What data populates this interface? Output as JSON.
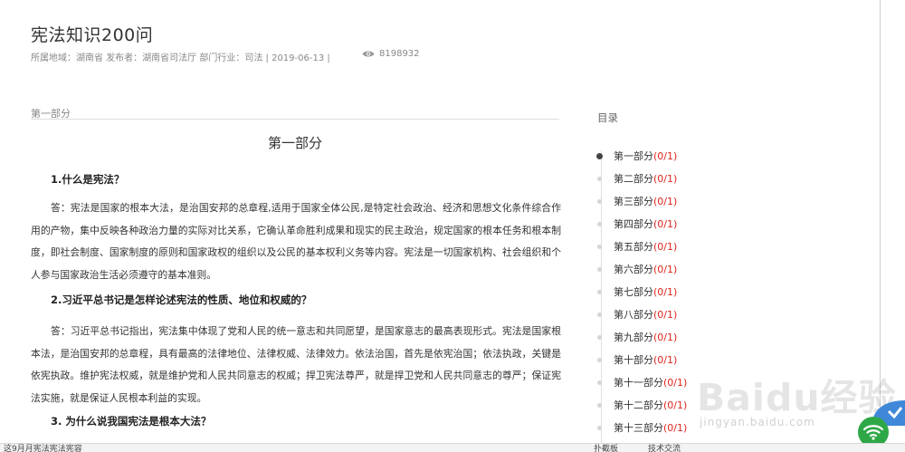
{
  "article": {
    "title": "宪法知识200问",
    "meta": "所属地域：湖南省 发布者：湖南省司法厅 部门行业：司法 | 2019-06-13 |",
    "views": "8198932",
    "section_label": "第一部分",
    "section_heading": "第一部分"
  },
  "qa": [
    {
      "q": "1.什么是宪法？",
      "a": "答：宪法是国家的根本大法，是治国安邦的总章程,适用于国家全体公民,是特定社会政治、经济和思想文化条件综合作用的产物，集中反映各种政治力量的实际对比关系，它确认革命胜利成果和现实的民主政治，规定国家的根本任务和根本制度，即社会制度、国家制度的原则和国家政权的组织以及公民的基本权利义务等内容。宪法是一切国家机构、社会组织和个人参与国家政治生活必须遵守的基本准则。"
    },
    {
      "q": "2.习近平总书记是怎样论述宪法的性质、地位和权威的？",
      "a": "答：习近平总书记指出，宪法集中体现了党和人民的统一意志和共同愿望，是国家意志的最高表现形式。宪法是国家根本法，是治国安邦的总章程，具有最高的法律地位、法律权威、法律效力。依法治国，首先是依宪治国；依法执政，关键是依宪执政。维护宪法权威，就是维护党和人民共同意志的权威；捍卫宪法尊严，就是捍卫党和人民共同意志的尊严；保证宪法实施，就是保证人民根本利益的实现。"
    },
    {
      "q": "3. 为什么说我国宪法是根本大法？",
      "a": ""
    }
  ],
  "toc": {
    "title": "目录",
    "items": [
      {
        "label": "第一部分",
        "count": "(0/1)"
      },
      {
        "label": "第二部分",
        "count": "(0/1)"
      },
      {
        "label": "第三部分",
        "count": "(0/1)"
      },
      {
        "label": "第四部分",
        "count": "(0/1)"
      },
      {
        "label": "第五部分",
        "count": "(0/1)"
      },
      {
        "label": "第六部分",
        "count": "(0/1)"
      },
      {
        "label": "第七部分",
        "count": "(0/1)"
      },
      {
        "label": "第八部分",
        "count": "(0/1)"
      },
      {
        "label": "第九部分",
        "count": "(0/1)"
      },
      {
        "label": "第十部分",
        "count": "(0/1)"
      },
      {
        "label": "第十一部分",
        "count": "(0/1)"
      },
      {
        "label": "第十二部分",
        "count": "(0/1)"
      },
      {
        "label": "第十三部分",
        "count": "(0/1)"
      }
    ]
  },
  "watermark": {
    "brand": "Baidu经验",
    "url": "jingyan.baidu.com"
  },
  "bottom_bar": {
    "left_text": "这9月月宪法宪法宪容",
    "item_1": "扑截板",
    "item_2": "技术交流"
  },
  "colors": {
    "count_red": "#e0241b",
    "wifi_green": "#2ea847"
  },
  "icons": {
    "views": "eye-icon",
    "wifi": "wifi-icon"
  }
}
